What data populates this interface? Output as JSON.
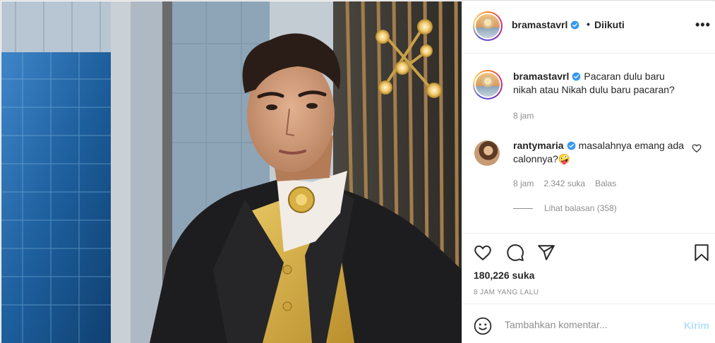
{
  "post": {
    "author": "bramastavrl",
    "follow_status": "Diikuti",
    "more_label": "•••",
    "caption": "Pacaran dulu baru nikah atau Nikah dulu baru pacaran?",
    "caption_time": "8 jam",
    "likes_label": "180,226 suka",
    "time_ago": "8 JAM YANG LALU"
  },
  "comments": [
    {
      "user": "rantymaria",
      "text": "masalahnya emang ada calonnya?",
      "emoji": "🤪",
      "time": "8 jam",
      "likes": "2.342 suka",
      "reply_label": "Balas",
      "view_replies": "Lihat balasan (358)"
    }
  ],
  "add_comment": {
    "placeholder": "Tambahkan komentar...",
    "post_label": "Kirim"
  },
  "icons": {
    "verified": "verified-badge-icon",
    "like": "heart-icon",
    "comment": "comment-bubble-icon",
    "share": "paper-plane-icon",
    "save": "bookmark-icon",
    "emoji": "smiley-icon",
    "more": "more-options-icon"
  },
  "colors": {
    "verified_blue": "#3897f0",
    "text_primary": "#262626",
    "text_secondary": "#8e8e8e",
    "post_button_disabled": "#b2dffc"
  }
}
